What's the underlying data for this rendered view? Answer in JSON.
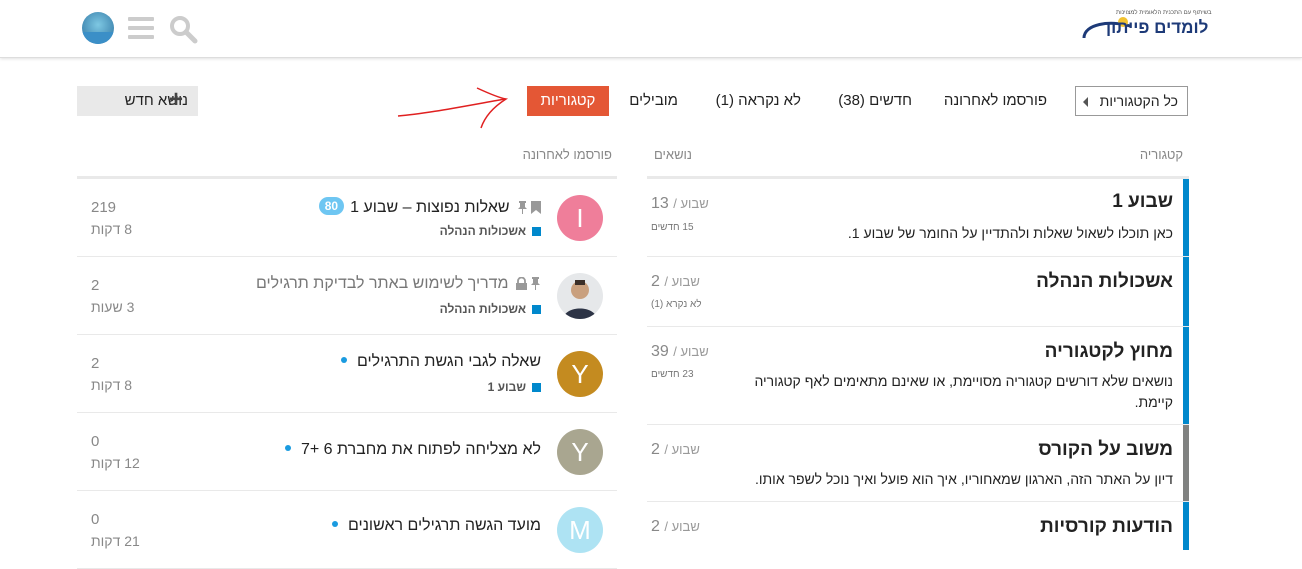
{
  "header": {
    "logo_text": "לומדים פייתון",
    "logo_small": "בשיתוף עם התכנית הלאומית למצוינות",
    "user_avatar": "user-avatar",
    "menu_icon": "hamburger-icon",
    "search_icon": "search-icon"
  },
  "nav": {
    "all_categories": "כל הקטגוריות",
    "latest": "פורסמו לאחרונה",
    "new": "חדשים (38)",
    "unread": "לא נקראה (1)",
    "top": "מובילים",
    "categories": "קטגוריות",
    "new_topic": "נושא חדש",
    "accent_color": "#e45735"
  },
  "columns": {
    "category": "קטגוריה",
    "topics": "נושאים",
    "latest": "פורסמו לאחרונה"
  },
  "categories": [
    {
      "name": "שבוע 1",
      "desc": "כאן תוכלו לשאול שאלות ולהתדיין על החומר של שבוע 1.",
      "count": "13",
      "period": "שבוע",
      "sub": "15 חדשים",
      "color": "#0088cc"
    },
    {
      "name": "אשכולות הנהלה",
      "desc": "",
      "count": "2",
      "period": "שבוע",
      "sub": "לא נקרא (1)",
      "color": "#0088cc"
    },
    {
      "name": "מחוץ לקטגוריה",
      "desc": "נושאים שלא דורשים קטגוריה מסויימת, או שאינם מתאימים לאף קטגוריה קיימת.",
      "count": "39",
      "period": "שבוע",
      "sub": "23 חדשים",
      "color": "#0088cc"
    },
    {
      "name": "משוב על הקורס",
      "desc": "דיון על האתר הזה, הארגון שמאחוריו, איך הוא פועל ואיך נוכל לשפר אותו.",
      "count": "2",
      "period": "שבוע",
      "sub": "",
      "color": "#808281"
    },
    {
      "name": "הודעות קורסיות",
      "desc": "",
      "count": "2",
      "period": "שבוע",
      "sub": "",
      "color": "#0088cc"
    }
  ],
  "topics": [
    {
      "avatar_letter": "I",
      "avatar_color": "#ef7e9a",
      "title": "שאלות נפוצות – שבוע 1",
      "badge": "80",
      "category": "אשכולות הנהלה",
      "replies": "219",
      "age": "8 דקות"
    },
    {
      "avatar_letter": "",
      "avatar_color": "#d9dde2",
      "title": "מדריך לשימוש באתר לבדיקת תרגילים",
      "badge": "",
      "category": "אשכולות הנהלה",
      "replies": "2",
      "age": "3 שעות"
    },
    {
      "avatar_letter": "Y",
      "avatar_color": "#c48b20",
      "title": "שאלה לגבי הגשת התרגילים",
      "badge": "",
      "category": "שבוע 1",
      "replies": "2",
      "age": "8 דקות"
    },
    {
      "avatar_letter": "Y",
      "avatar_color": "#a9a690",
      "title": "לא מצליחה לפתוח את מחברת 6 +7",
      "badge": "",
      "category": "",
      "replies": "0",
      "age": "12 דקות"
    },
    {
      "avatar_letter": "M",
      "avatar_color": "#aee3f3",
      "title": "מועד הגשה תרגילים ראשונים",
      "badge": "",
      "category": "",
      "replies": "0",
      "age": "21 דקות"
    }
  ]
}
